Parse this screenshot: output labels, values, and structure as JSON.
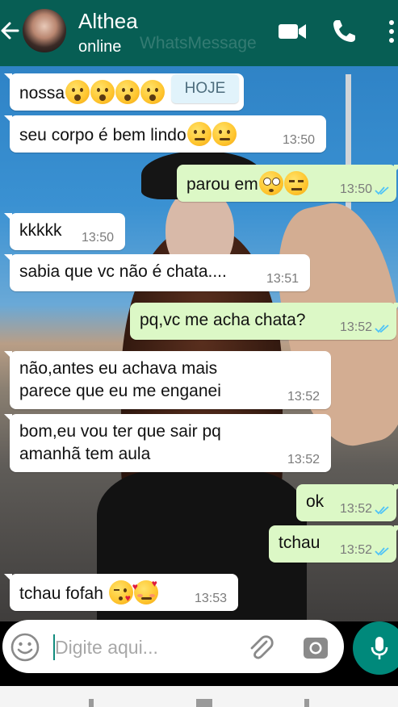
{
  "header": {
    "contact_name": "Althea",
    "status": "online",
    "watermark": "WhatsMessage",
    "icons": [
      "back-arrow-icon",
      "video-call-icon",
      "phone-call-icon",
      "more-menu-icon"
    ]
  },
  "date_chip": "HOJE",
  "messages": [
    {
      "dir": "in",
      "text": "nossa",
      "emojis": [
        "astonished",
        "astonished",
        "astonished",
        "astonished"
      ],
      "time": ""
    },
    {
      "dir": "in",
      "text": "seu corpo é bem lindo",
      "emojis": [
        "smirk",
        "smirk"
      ],
      "time": "13:50"
    },
    {
      "dir": "out",
      "text": "parou em",
      "emojis": [
        "flushed",
        "expressionless"
      ],
      "time": "13:50",
      "read": true
    },
    {
      "dir": "in",
      "text": "kkkkk",
      "time": "13:50"
    },
    {
      "dir": "in",
      "text": "sabia que vc não é chata....",
      "time": "13:51"
    },
    {
      "dir": "out",
      "text": "pq,vc me acha chata?",
      "time": "13:52",
      "read": true
    },
    {
      "dir": "in",
      "text_lines": [
        "não,antes eu achava mais",
        "parece que eu me enganei"
      ],
      "time": "13:52"
    },
    {
      "dir": "in",
      "text_lines": [
        "bom,eu vou ter que sair pq",
        "amanhã tem aula"
      ],
      "time": "13:52"
    },
    {
      "dir": "out",
      "text": "ok",
      "time": "13:52",
      "read": true
    },
    {
      "dir": "out",
      "text": "tchau",
      "time": "13:52",
      "read": true
    },
    {
      "dir": "in",
      "text": "tchau fofah",
      "emojis": [
        "kissing-heart",
        "smiling-hearts"
      ],
      "time": "13:53"
    }
  ],
  "composer": {
    "placeholder": "Digite aqui...",
    "icons": [
      "emoji-icon",
      "attach-icon",
      "camera-icon",
      "mic-icon"
    ]
  },
  "colors": {
    "header": "#075e54",
    "incoming_bubble": "#ffffff",
    "outgoing_bubble": "#dcf8c6",
    "read_ticks": "#4fc3f7",
    "mic_button": "#00897b"
  }
}
